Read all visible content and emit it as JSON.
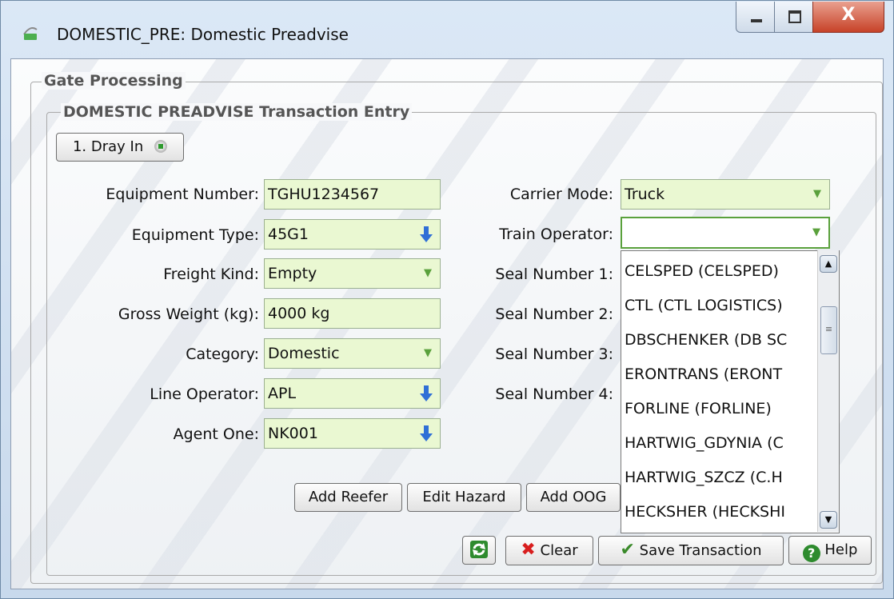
{
  "window": {
    "title": "DOMESTIC_PRE: Domestic Preadvise"
  },
  "groups": {
    "outer": "Gate Processing",
    "inner": "DOMESTIC PREADVISE Transaction Entry"
  },
  "step_button": "1. Dray In",
  "left_fields": [
    {
      "label": "Equipment Number:",
      "value": "TGHU1234567"
    },
    {
      "label": "Equipment Type:",
      "value": "45G1"
    },
    {
      "label": "Freight Kind:",
      "value": "Empty"
    },
    {
      "label": "Gross Weight (kg):",
      "value": "4000 kg"
    },
    {
      "label": "Category:",
      "value": "Domestic"
    },
    {
      "label": "Line Operator:",
      "value": "APL"
    },
    {
      "label": "Agent One:",
      "value": "NK001"
    }
  ],
  "right_fields": [
    {
      "label": "Carrier Mode:",
      "value": "Truck"
    },
    {
      "label": "Train Operator:",
      "value": ""
    },
    {
      "label": "Seal Number 1:"
    },
    {
      "label": "Seal Number 2:"
    },
    {
      "label": "Seal Number 3:"
    },
    {
      "label": "Seal Number 4:"
    }
  ],
  "train_operator_options": [
    "CELSPED (CELSPED)",
    "CTL (CTL LOGISTICS)",
    "DBSCHENKER (DB SC",
    "ERONTRANS (ERONT",
    "FORLINE (FORLINE)",
    "HARTWIG_GDYNIA (C",
    "HARTWIG_SZCZ (C.H",
    "HECKSHER (HECKSHI"
  ],
  "action_buttons": {
    "add_reefer": "Add Reefer",
    "edit_hazard": "Edit Hazard",
    "add_oog": "Add OOG"
  },
  "footer_buttons": {
    "clear": "Clear",
    "save": "Save Transaction",
    "help": "Help"
  },
  "colors": {
    "field_bg": "#eaf8d2",
    "lookup_arrow": "#2f6fd6",
    "dropdown_arrow": "#5aa13c",
    "clear_x": "#d81e1e",
    "save_check": "#3a8a2a"
  },
  "icons": {
    "refresh": "refresh-icon",
    "clear": "x-icon",
    "save": "check-icon",
    "help": "help-icon",
    "lookup": "arrow-down-icon"
  }
}
